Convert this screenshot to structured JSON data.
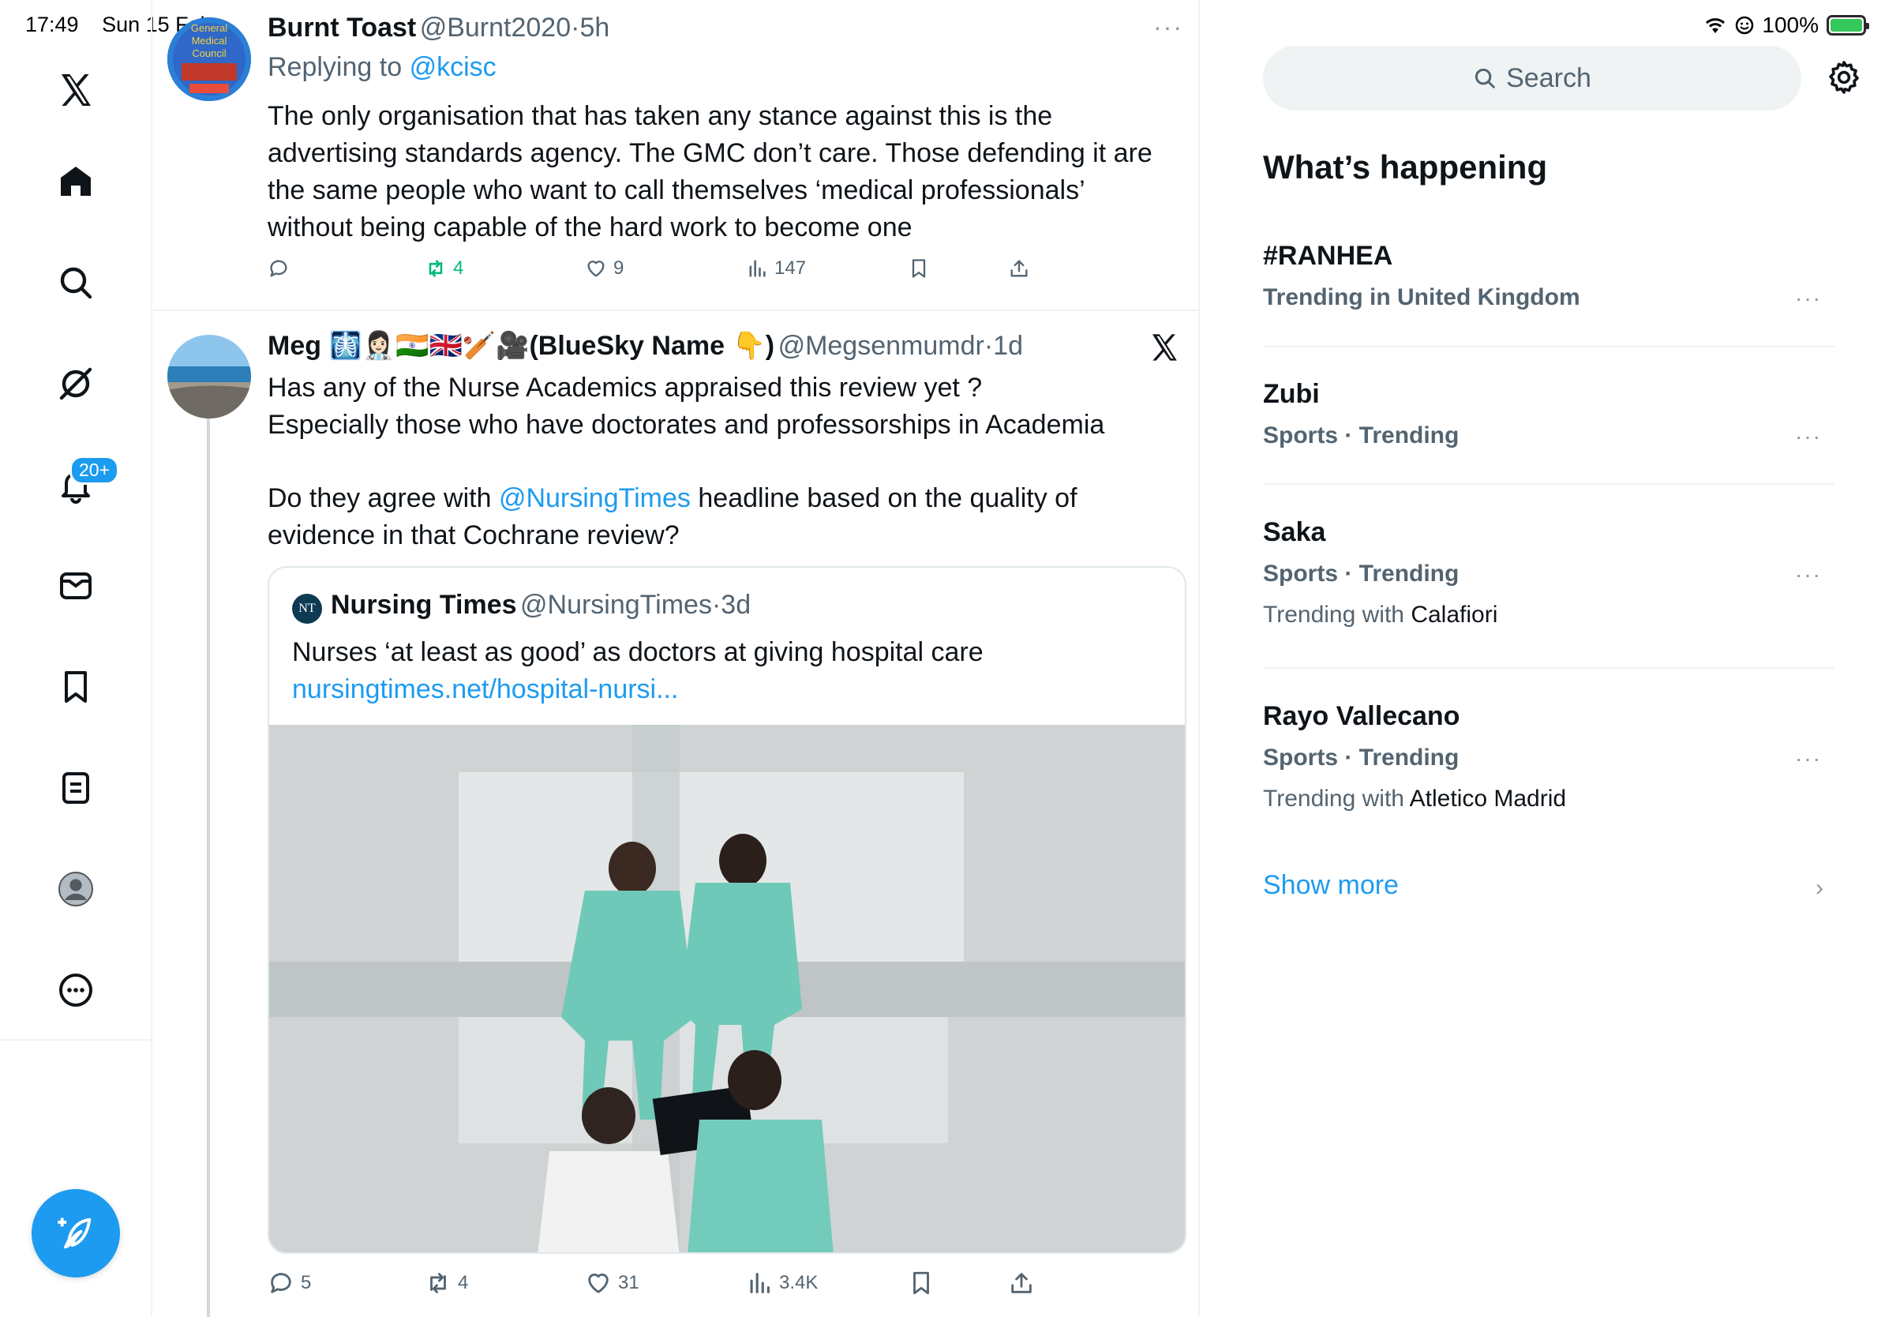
{
  "status_bar": {
    "time": "17:49",
    "date": "Sun 15 Feb",
    "battery": "100%",
    "battery_level": 1.0
  },
  "nav": {
    "items": [
      "x-logo",
      "home",
      "explore",
      "grok",
      "notifications",
      "messages",
      "bookmarks",
      "lists",
      "profile",
      "more"
    ],
    "notifications_badge": "20+"
  },
  "tweet1": {
    "name": "Burnt Toast",
    "handle": "@Burnt2020",
    "sep": "·",
    "time": "5h",
    "replying_prefix": "Replying to",
    "replying_handle": "@kcisc",
    "text_lines": [
      "The only organisation that has taken any stance against this is the",
      "advertising standards agency. The GMC don’t care. Those defending it are",
      "the same people who want to call themselves ‘medical professionals’",
      "without being capable of the hard work to become one"
    ],
    "stats": {
      "replies": "",
      "reposts": "4",
      "likes": "9",
      "views": "147"
    },
    "avatar_text": [
      "General",
      "Medical",
      "Council"
    ]
  },
  "tweet2": {
    "name": "Meg 🩻👩🏻‍⚕️🇮🇳🇬🇧🏏🎥(BlueSky Name 👇)",
    "handle": "@Megsenmumdr",
    "sep": "·",
    "time": "1d",
    "text_line1": "Has any of the Nurse Academics appraised this review yet ?",
    "text_line2": "Especially those who have doctorates and professorships in Academia",
    "text_line3_prefix": "Do they agree with",
    "text_line3_mention": "@NursingTimes",
    "text_line3_suffix": "headline based on the quality of",
    "text_line4": "evidence in that Cochrane review?",
    "quote": {
      "avatar": "NT",
      "name": "Nursing Times",
      "handle": "@NursingTimes",
      "sep": "·",
      "time": "3d",
      "text": "Nurses ‘at least as good’ as doctors at giving hospital care",
      "link": "nursingtimes.net/hospital-nursi..."
    },
    "stats": {
      "replies": "5",
      "reposts": "4",
      "likes": "31",
      "views": "3.4K"
    }
  },
  "sidebar": {
    "search_placeholder": "Search",
    "whats_happening": "What’s happening",
    "trends": [
      {
        "title": "#RANHEA",
        "meta": "Trending in United Kingdom",
        "with_prefix": "",
        "with_name": ""
      },
      {
        "title": "Zubi",
        "meta": "Sports · Trending",
        "with_prefix": "",
        "with_name": ""
      },
      {
        "title": "Saka",
        "meta": "Sports · Trending",
        "with_prefix": "Trending with",
        "with_name": "Calafiori"
      },
      {
        "title": "Rayo Vallecano",
        "meta": "Sports · Trending",
        "with_prefix": "Trending with",
        "with_name": "Atletico Madrid"
      }
    ],
    "show_more": "Show more"
  },
  "colors": {
    "accent": "#1d9bf0",
    "repost_active": "#00ba7c",
    "text": "#0f1419",
    "muted": "#536471"
  }
}
